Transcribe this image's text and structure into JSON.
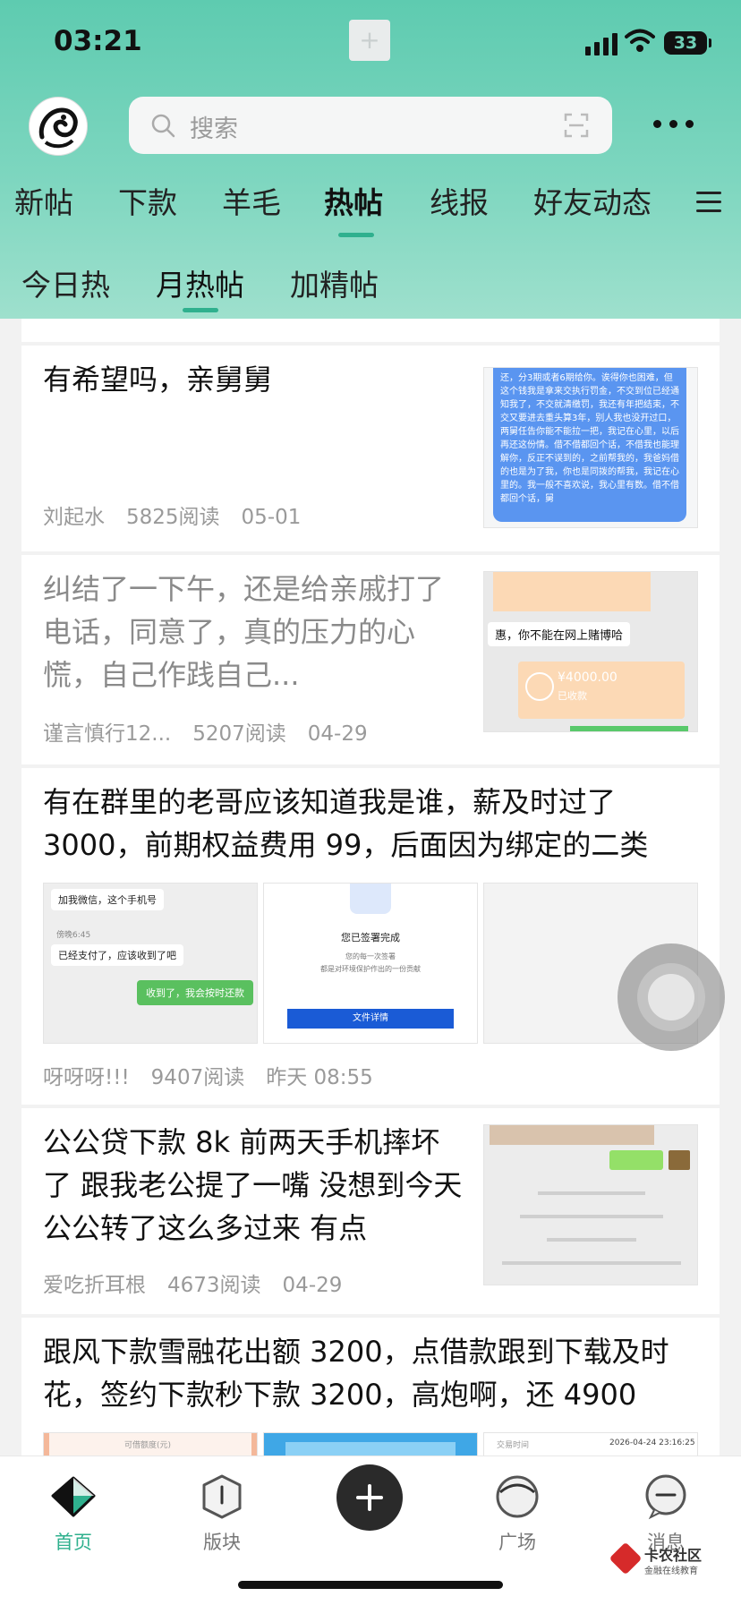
{
  "status_bar": {
    "time": "03:21",
    "battery": "33"
  },
  "search": {
    "placeholder": "搜索"
  },
  "tabs": [
    {
      "label": "新帖"
    },
    {
      "label": "下款"
    },
    {
      "label": "羊毛"
    },
    {
      "label": "热帖"
    },
    {
      "label": "线报"
    },
    {
      "label": "好友动态"
    }
  ],
  "active_tab": "热帖",
  "subtabs": [
    {
      "label": "今日热"
    },
    {
      "label": "月热帖"
    },
    {
      "label": "加精帖"
    }
  ],
  "active_subtab": "月热帖",
  "posts": [
    {
      "title": "有希望吗，亲舅舅",
      "author": "刘起水",
      "reads": "5825阅读",
      "date": "05-01",
      "thumb_text": "还，分3期或者6期给你。诶得你也困难，但这个钱我是拿来交执行罚金，不交到位已经通知我了，不交就清缴罚，我还有年把结束，不交又要进去重头算3年，别人我也没开过口，两舅任告你能不能拉一把，我记在心里，以后再还这份情。借不借都回个话，不借我也能理解你，反正不误到的，之前帮我的，我爸妈借的也是为了我，你也是同拨的帮我，我记在心里的。我一般不喜欢说，我心里有数。借不借都回个话，舅"
    },
    {
      "title": "纠结了一下午，还是给亲戚打了电话，同意了，真的压力的心慌，自己作践自己...",
      "author": "谨言慎行12...",
      "reads": "5207阅读",
      "date": "04-29",
      "thumb_bubble": "惠，你不能在网上赌博哈",
      "thumb_amount": "¥4000.00",
      "thumb_received": "已收款"
    },
    {
      "title": "有在群里的老哥应该知道我是谁，薪及时过了 3000，前期权益费用 99，后面因为绑定的二类",
      "author": "呀呀呀!!!",
      "reads": "9407阅读",
      "date": "昨天 08:55",
      "t1_a": "加我微信，这个手机号",
      "t1_time": "傍晚6:45",
      "t1_b": "已经支付了，应该收到了吧",
      "t1_c": "收到了，我会按时还款",
      "t2_title": "您已签署完成",
      "t2_sub": "您的每一次签署",
      "t2_sub2": "都是对环境保护作出的一份贡献",
      "t2_btn": "文件详情"
    },
    {
      "title": "公公贷下款 8k  前两天手机摔坏了 跟我老公提了一嘴 没想到今天公公转了这么多过来 有点",
      "author": "爱吃折耳根",
      "reads": "4673阅读",
      "date": "04-29"
    },
    {
      "title": "跟风下款雪融花出额 3200，点借款跟到下载及时花，签约下款秒下款 3200，高炮啊，还 4900",
      "thumb_left": "可借额度(元)",
      "thumb_right_a": "交易时间",
      "thumb_right_b": "2026-04-24 23:16:25"
    }
  ],
  "bottom_nav": [
    {
      "label": "首页"
    },
    {
      "label": "版块"
    },
    {
      "label": "广场"
    },
    {
      "label": "消息"
    }
  ],
  "watermark": {
    "title": "卡农社区",
    "subtitle": "金融在线教育"
  },
  "colors": {
    "accent": "#2fb08e",
    "header_top": "#5ecbb0"
  }
}
